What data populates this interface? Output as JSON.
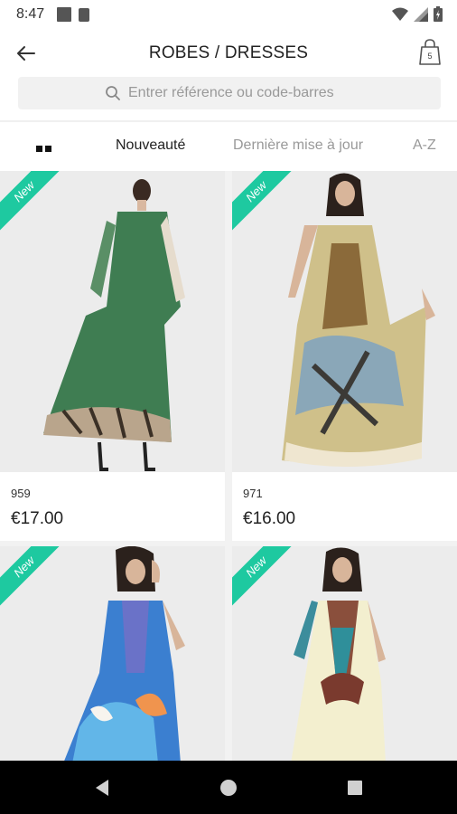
{
  "status_bar": {
    "time": "8:47",
    "icons": [
      "notification-square-icon",
      "sim-card-icon",
      "wifi-icon",
      "signal-icon",
      "battery-icon"
    ]
  },
  "app_bar": {
    "title": "ROBES / DRESSES",
    "back_icon": "arrow-left-icon",
    "bag_icon": "shopping-bag-icon",
    "bag_count": "5"
  },
  "search": {
    "placeholder": "Entrer référence ou code-barres",
    "value": "",
    "icon": "search-icon"
  },
  "sort": {
    "grid_toggle_icon": "grid-view-icon",
    "tabs": [
      {
        "label": "Nouveauté",
        "active": true
      },
      {
        "label": "Dernière mise à jour",
        "active": false
      },
      {
        "label": "A-Z",
        "active": false
      }
    ]
  },
  "products": [
    {
      "badge": "New",
      "ref": "959",
      "price": "€17.00"
    },
    {
      "badge": "New",
      "ref": "971",
      "price": "€16.00"
    },
    {
      "badge": "New",
      "ref": "",
      "price": ""
    },
    {
      "badge": "New",
      "ref": "",
      "price": ""
    }
  ],
  "colors": {
    "badge": "#1ec9a0",
    "nav_bar": "#000000",
    "search_bg": "#f1f1f1"
  },
  "nav_bar": {
    "icons": [
      "back-triangle-icon",
      "home-circle-icon",
      "recents-square-icon"
    ]
  }
}
